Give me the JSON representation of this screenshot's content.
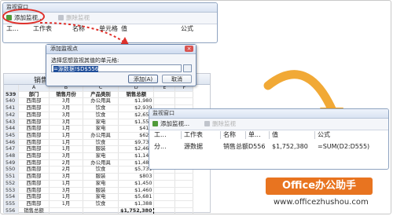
{
  "top_window": {
    "title": "监视窗口",
    "add_watch": "添加监视...",
    "delete_watch": "删除监视",
    "columns": [
      "工...",
      "工作表",
      "名称",
      "单元格",
      "值",
      "公式"
    ]
  },
  "dialog": {
    "title": "添加监视点",
    "prompt": "选择您想监视其值的单元格:",
    "reference": "=源数据!$D$556",
    "add_button": "添加(A)",
    "cancel_button": "取消"
  },
  "sheet": {
    "title_row": "销售总额",
    "col_letters": [
      "A",
      "B",
      "C",
      "D",
      "E",
      "F"
    ],
    "header": {
      "num": "539",
      "cells": [
        "部门",
        "销售月份",
        "产品类别",
        "销售总额"
      ]
    },
    "rows": [
      {
        "num": "540",
        "cells": [
          "西南部",
          "3月",
          "办公用具",
          "$1,980"
        ]
      },
      {
        "num": "541",
        "cells": [
          "西南部",
          "3月",
          "饮食",
          "$2,939"
        ]
      },
      {
        "num": "542",
        "cells": [
          "西南部",
          "3月",
          "饮食",
          "$2,652"
        ]
      },
      {
        "num": "543",
        "cells": [
          "西南部",
          "3月",
          "家电",
          "$1,550"
        ]
      },
      {
        "num": "544",
        "cells": [
          "西南部",
          "1月",
          "家电",
          "$410"
        ]
      },
      {
        "num": "545",
        "cells": [
          "西南部",
          "1月",
          "办公用具",
          "$623"
        ]
      },
      {
        "num": "546",
        "cells": [
          "西南部",
          "1月",
          "饮食",
          "$9,730"
        ]
      },
      {
        "num": "547",
        "cells": [
          "西南部",
          "1月",
          "服装",
          "$2,460"
        ]
      },
      {
        "num": "548",
        "cells": [
          "西南部",
          "3月",
          "家电",
          "$1,145"
        ]
      },
      {
        "num": "549",
        "cells": [
          "西南部",
          "2月",
          "办公用具",
          "$1,480"
        ]
      },
      {
        "num": "550",
        "cells": [
          "西南部",
          "2月",
          "饮食",
          "$5,731"
        ]
      },
      {
        "num": "551",
        "cells": [
          "西南部",
          "3月",
          "服装",
          "$803"
        ]
      },
      {
        "num": "552",
        "cells": [
          "西南部",
          "1月",
          "家电",
          "$1,450"
        ]
      },
      {
        "num": "553",
        "cells": [
          "西南部",
          "3月",
          "服装",
          "$1,460"
        ]
      },
      {
        "num": "554",
        "cells": [
          "西南部",
          "1月",
          "家电",
          "$5,681"
        ]
      },
      {
        "num": "555",
        "cells": [
          "西南部",
          "1月",
          "饮食",
          "$1,388"
        ]
      }
    ],
    "sum_row": {
      "num": "556",
      "label": "销售总额",
      "value": "$1,752,380"
    }
  },
  "bottom_window": {
    "title": "监视窗口",
    "add_watch": "添加监视...",
    "delete_watch": "删除监视",
    "columns": [
      "工...",
      "工作表",
      "名称",
      "单...",
      "值",
      "公式"
    ],
    "row": {
      "book": "分...",
      "sheet": "源数据",
      "name": "销售总额",
      "cell": "D556",
      "value": "$1,752,380",
      "formula": "=SUM(D2:D555)"
    }
  },
  "watermark": {
    "brand": "Office办公助手",
    "url": "www.officezhushou.com"
  },
  "colors": {
    "highlight_red": "#e0312b",
    "arrow_orange": "#f0a020",
    "accent_blue": "#1f4e9a"
  }
}
